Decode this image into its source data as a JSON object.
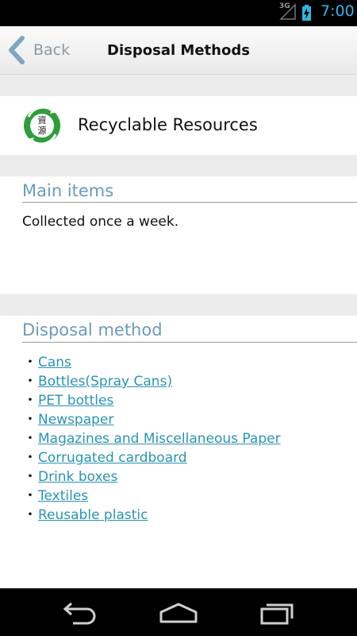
{
  "status_bar": {
    "network": "3G",
    "time": "7:00"
  },
  "action_bar": {
    "back_label": "Back",
    "title": "Disposal Methods"
  },
  "category": {
    "icon": "recycle-resources-icon",
    "label": "Recyclable Resources"
  },
  "main_items": {
    "header": "Main items",
    "text": "Collected once a week."
  },
  "disposal_method": {
    "header": "Disposal method",
    "bullet": "・",
    "items": [
      "Cans",
      "Bottles(Spray Cans)",
      "PET bottles",
      "Newspaper",
      "Magazines and Miscellaneous Paper",
      "Corrugated cardboard",
      "Drink boxes",
      "Textiles",
      "Reusable plastic"
    ]
  },
  "nav_bar": {
    "icons": [
      "back-icon",
      "home-icon",
      "recent-apps-icon"
    ]
  },
  "colors": {
    "accent": "#33b5e5",
    "header_text": "#6b9bbd",
    "link": "#2a94b4",
    "gap": "#ececec"
  }
}
